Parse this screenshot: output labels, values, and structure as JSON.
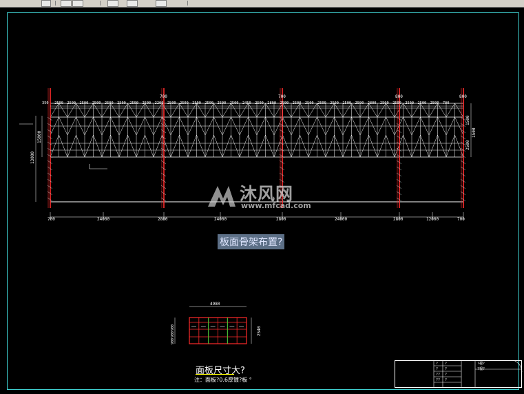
{
  "drawing": {
    "main_caption": "板面骨架布置?",
    "panel_caption": "面板尺寸大?",
    "panel_note": "注：面板?0.6厚镀?板 °",
    "watermark_cn": "沐风网",
    "watermark_url": "www.mfcad.com",
    "top_dims": [
      "350",
      "2500",
      "2500",
      "2500",
      "2500",
      "2500",
      "2500",
      "2500",
      "2500",
      "2200",
      "2500",
      "2500",
      "2500",
      "2500",
      "2500",
      "2500",
      "2450",
      "2500",
      "2800",
      "2500",
      "2500",
      "2500",
      "2500",
      "2500",
      "2500",
      "2500",
      "2800",
      "2500",
      "2500",
      "2500",
      "2500",
      "2500",
      "700"
    ],
    "post_top_labels": [
      "700",
      "700",
      "700",
      "800"
    ],
    "bottom_dims": [
      "700",
      "24000",
      "2800",
      "24000",
      "2800",
      "24000",
      "2800",
      "12000",
      "700"
    ],
    "left_dims": [
      "13000",
      "15000"
    ],
    "right_dims": [
      "1500",
      "1500",
      "2500"
    ],
    "panel_top_dim": "4980",
    "panel_right_dim": "2540",
    "panel_left_dims": [
      "900",
      "900",
      "900"
    ],
    "title_block_cells": [
      "?",
      "?",
      "??",
      "??",
      "?",
      "?",
      "?",
      "?",
      "?",
      "?"
    ],
    "title_block_names": [
      "?视?",
      "?视?"
    ]
  },
  "colors": {
    "frame": "#3fd0d0",
    "steel": "#ffffff",
    "column": "#ff2a2a",
    "highlight": "#39d639",
    "dimension": "#ffffff"
  }
}
